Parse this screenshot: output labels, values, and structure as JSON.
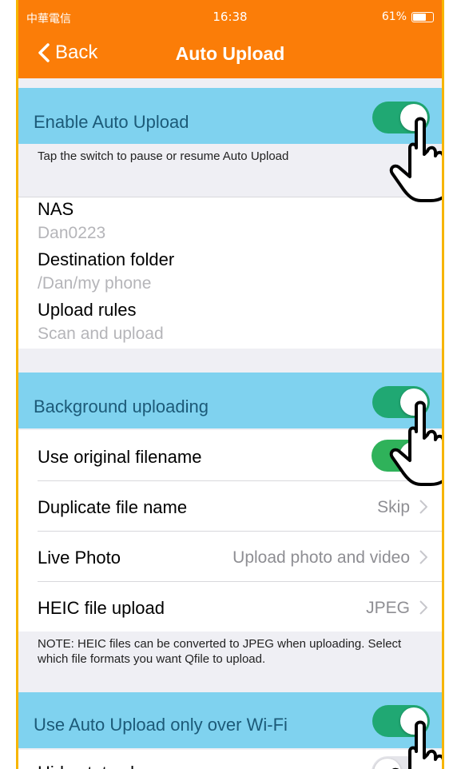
{
  "status_bar": {
    "carrier": "中華電信",
    "time": "16:38",
    "battery": "61%"
  },
  "nav": {
    "back_label": "Back",
    "title": "Auto Upload"
  },
  "enable": {
    "label": "Enable Auto Upload",
    "on": true
  },
  "enable_note": "Tap the switch to pause or resume Auto Upload",
  "info": [
    {
      "title": "NAS",
      "value": "Dan0223"
    },
    {
      "title": "Destination folder",
      "value": "/Dan/my phone"
    },
    {
      "title": "Upload rules",
      "value": "Scan and upload"
    }
  ],
  "background": {
    "label": "Background uploading",
    "on": true
  },
  "settings": [
    {
      "label": "Use original filename",
      "value": ""
    },
    {
      "label": "Duplicate file name",
      "value": "Skip"
    },
    {
      "label": "Live Photo",
      "value": "Upload photo and video"
    },
    {
      "label": "HEIC file upload",
      "value": "JPEG"
    }
  ],
  "heic_note": "NOTE: HEIC files can be converted to JPEG when uploading. Select which file formats you want Qfile to upload.",
  "wifi": {
    "label": "Use Auto Upload only over Wi-Fi",
    "on": true
  },
  "partial": {
    "label": "Hide status bar"
  },
  "colors": {
    "accent": "#fb7d08",
    "toggle_on": "#2fb25a",
    "highlight": "#7fd2ef",
    "frame": "#f7b500"
  }
}
